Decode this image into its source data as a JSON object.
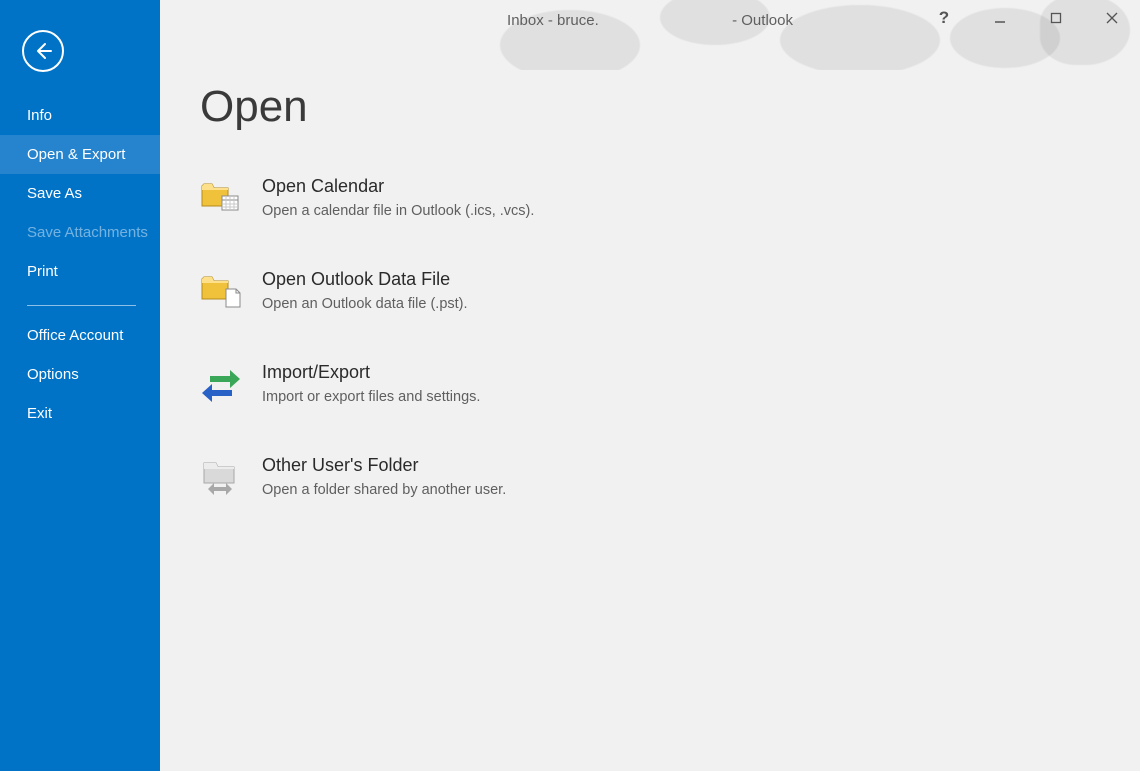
{
  "window": {
    "title": "Inbox - bruce.                                - Outlook"
  },
  "sidebar": {
    "items": [
      {
        "label": "Info"
      },
      {
        "label": "Open & Export"
      },
      {
        "label": "Save As"
      },
      {
        "label": "Save Attachments"
      },
      {
        "label": "Print"
      },
      {
        "label": "Office Account"
      },
      {
        "label": "Options"
      },
      {
        "label": "Exit"
      }
    ]
  },
  "page": {
    "title": "Open"
  },
  "options": [
    {
      "title": "Open Calendar",
      "desc": "Open a calendar file in Outlook (.ics, .vcs)."
    },
    {
      "title": "Open Outlook Data File",
      "desc": "Open an Outlook data file (.pst)."
    },
    {
      "title": "Import/Export",
      "desc": "Import or export files and settings."
    },
    {
      "title": "Other User's Folder",
      "desc": "Open a folder shared by another user."
    }
  ]
}
